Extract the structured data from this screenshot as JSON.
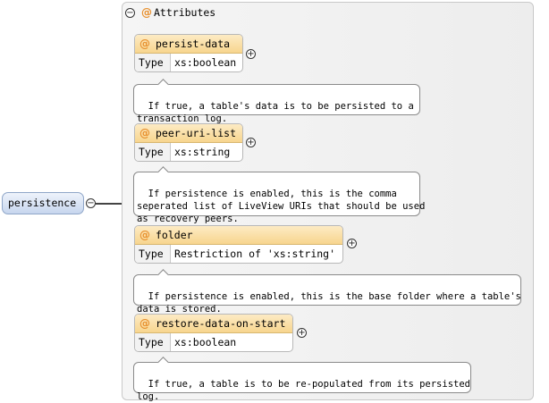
{
  "root": {
    "name": "persistence",
    "toggle": "−"
  },
  "attributes": {
    "title": "Attributes",
    "at_symbol": "@",
    "toggle": "−",
    "items": [
      {
        "name": "persist-data",
        "type_label": "Type",
        "type": "xs:boolean",
        "doc": "If true, a table's data is to be persisted to a\ntransaction log.",
        "expand": "+"
      },
      {
        "name": "peer-uri-list",
        "type_label": "Type",
        "type": "xs:string",
        "doc": "If persistence is enabled, this is the comma\nseperated list of LiveView URIs that should be used\nas recovery peers.",
        "expand": "+"
      },
      {
        "name": "folder",
        "type_label": "Type",
        "type": "Restriction of 'xs:string'",
        "doc": "If persistence is enabled, this is the base folder where a table's\ndata is stored.",
        "expand": "+"
      },
      {
        "name": "restore-data-on-start",
        "type_label": "Type",
        "type": "xs:boolean",
        "doc": "If true, a table is to be re-populated from its persisted\nlog.",
        "expand": "+"
      }
    ]
  },
  "colors": {
    "root_fill": "#c7d6ee",
    "card_header": "#f7d58e",
    "at_symbol": "#e8902e"
  }
}
